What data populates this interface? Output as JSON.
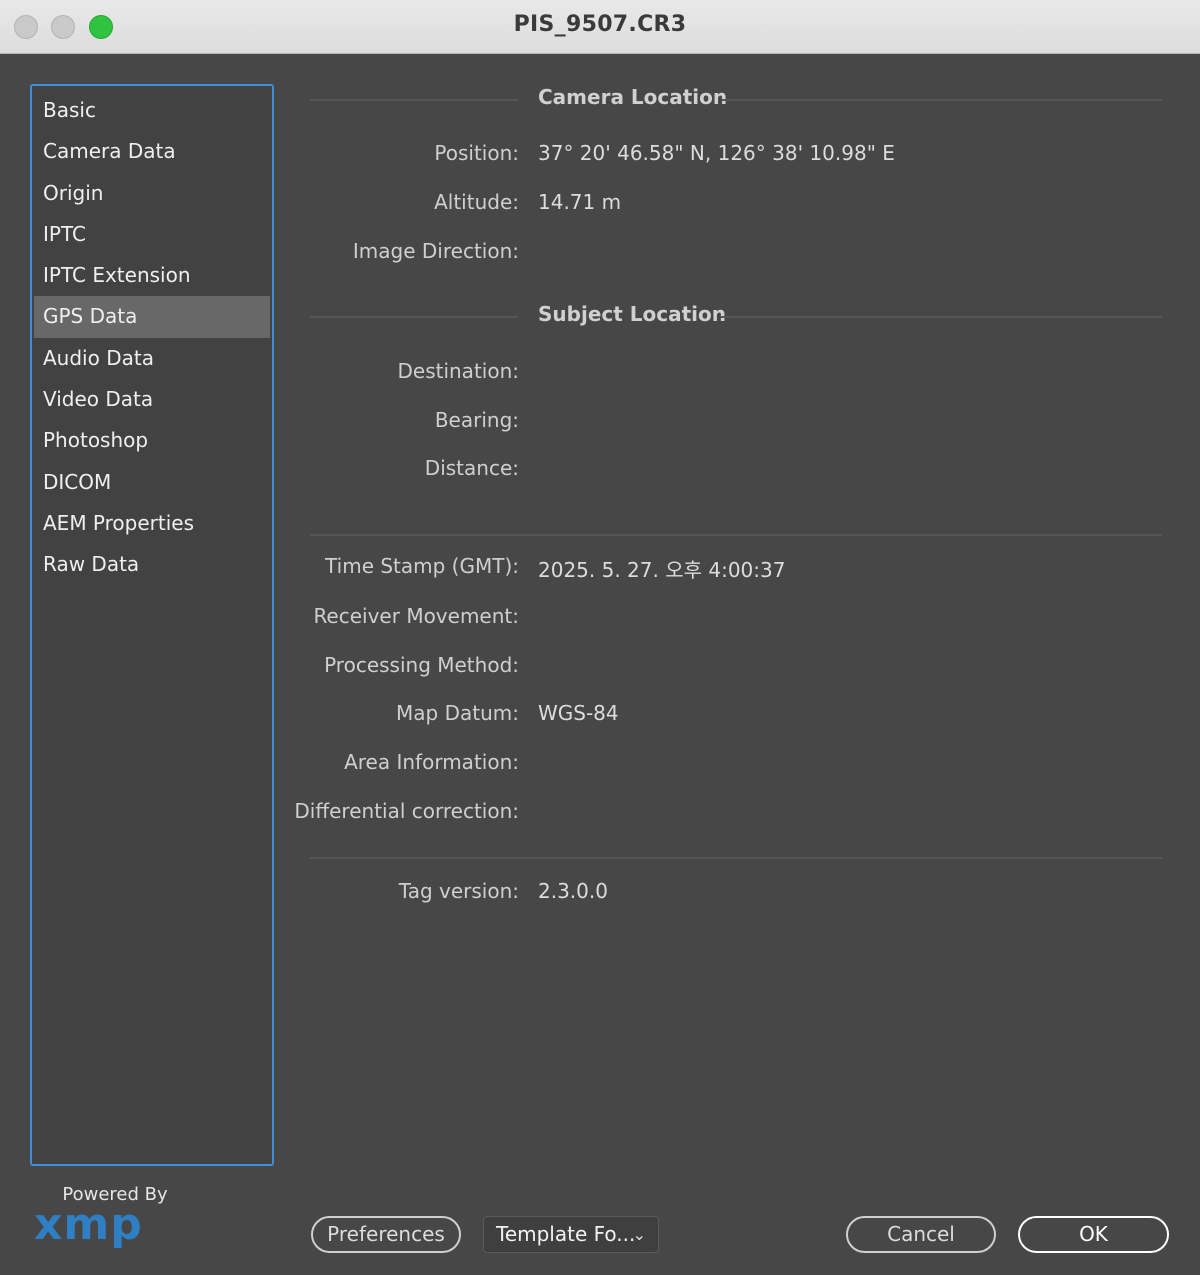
{
  "window": {
    "title": "PIS_9507.CR3"
  },
  "sidebar": {
    "items": [
      {
        "label": "Basic"
      },
      {
        "label": "Camera Data"
      },
      {
        "label": "Origin"
      },
      {
        "label": "IPTC"
      },
      {
        "label": "IPTC Extension"
      },
      {
        "label": "GPS Data",
        "selected": true
      },
      {
        "label": "Audio Data"
      },
      {
        "label": "Video Data"
      },
      {
        "label": "Photoshop"
      },
      {
        "label": "DICOM"
      },
      {
        "label": "AEM Properties"
      },
      {
        "label": "Raw Data"
      }
    ]
  },
  "camera_location": {
    "heading": "Camera Location",
    "position_label": "Position:",
    "position_value": "37° 20' 46.58\" N,  126° 38' 10.98\" E",
    "altitude_label": "Altitude:",
    "altitude_value": "14.71 m",
    "image_direction_label": "Image Direction:",
    "image_direction_value": ""
  },
  "subject_location": {
    "heading": "Subject Location",
    "destination_label": "Destination:",
    "destination_value": "",
    "bearing_label": "Bearing:",
    "bearing_value": "",
    "distance_label": "Distance:",
    "distance_value": ""
  },
  "gps_details": {
    "timestamp_label": "Time Stamp (GMT):",
    "timestamp_value": "2025. 5. 27. 오후 4:00:37",
    "receiver_movement_label": "Receiver Movement:",
    "receiver_movement_value": "",
    "processing_method_label": "Processing Method:",
    "processing_method_value": "",
    "map_datum_label": "Map Datum:",
    "map_datum_value": "WGS-84",
    "area_information_label": "Area Information:",
    "area_information_value": "",
    "differential_correction_label": "Differential correction:",
    "differential_correction_value": ""
  },
  "tag": {
    "version_label": "Tag version:",
    "version_value": "2.3.0.0"
  },
  "footer": {
    "powered_by": "Powered By",
    "logo_text": "xmp",
    "preferences_label": "Preferences",
    "template_dropdown_label": "Template Fo...",
    "cancel_label": "Cancel",
    "ok_label": "OK"
  },
  "icons": {
    "dropdown": "chevron-down-icon",
    "close": "close-button-icon",
    "minimize": "minimize-button-icon",
    "zoom": "zoom-button-icon"
  },
  "colors": {
    "accent": "#3d8fd8",
    "zoom_green": "#2fc341",
    "xmp_blue": "#2e7fc3"
  }
}
